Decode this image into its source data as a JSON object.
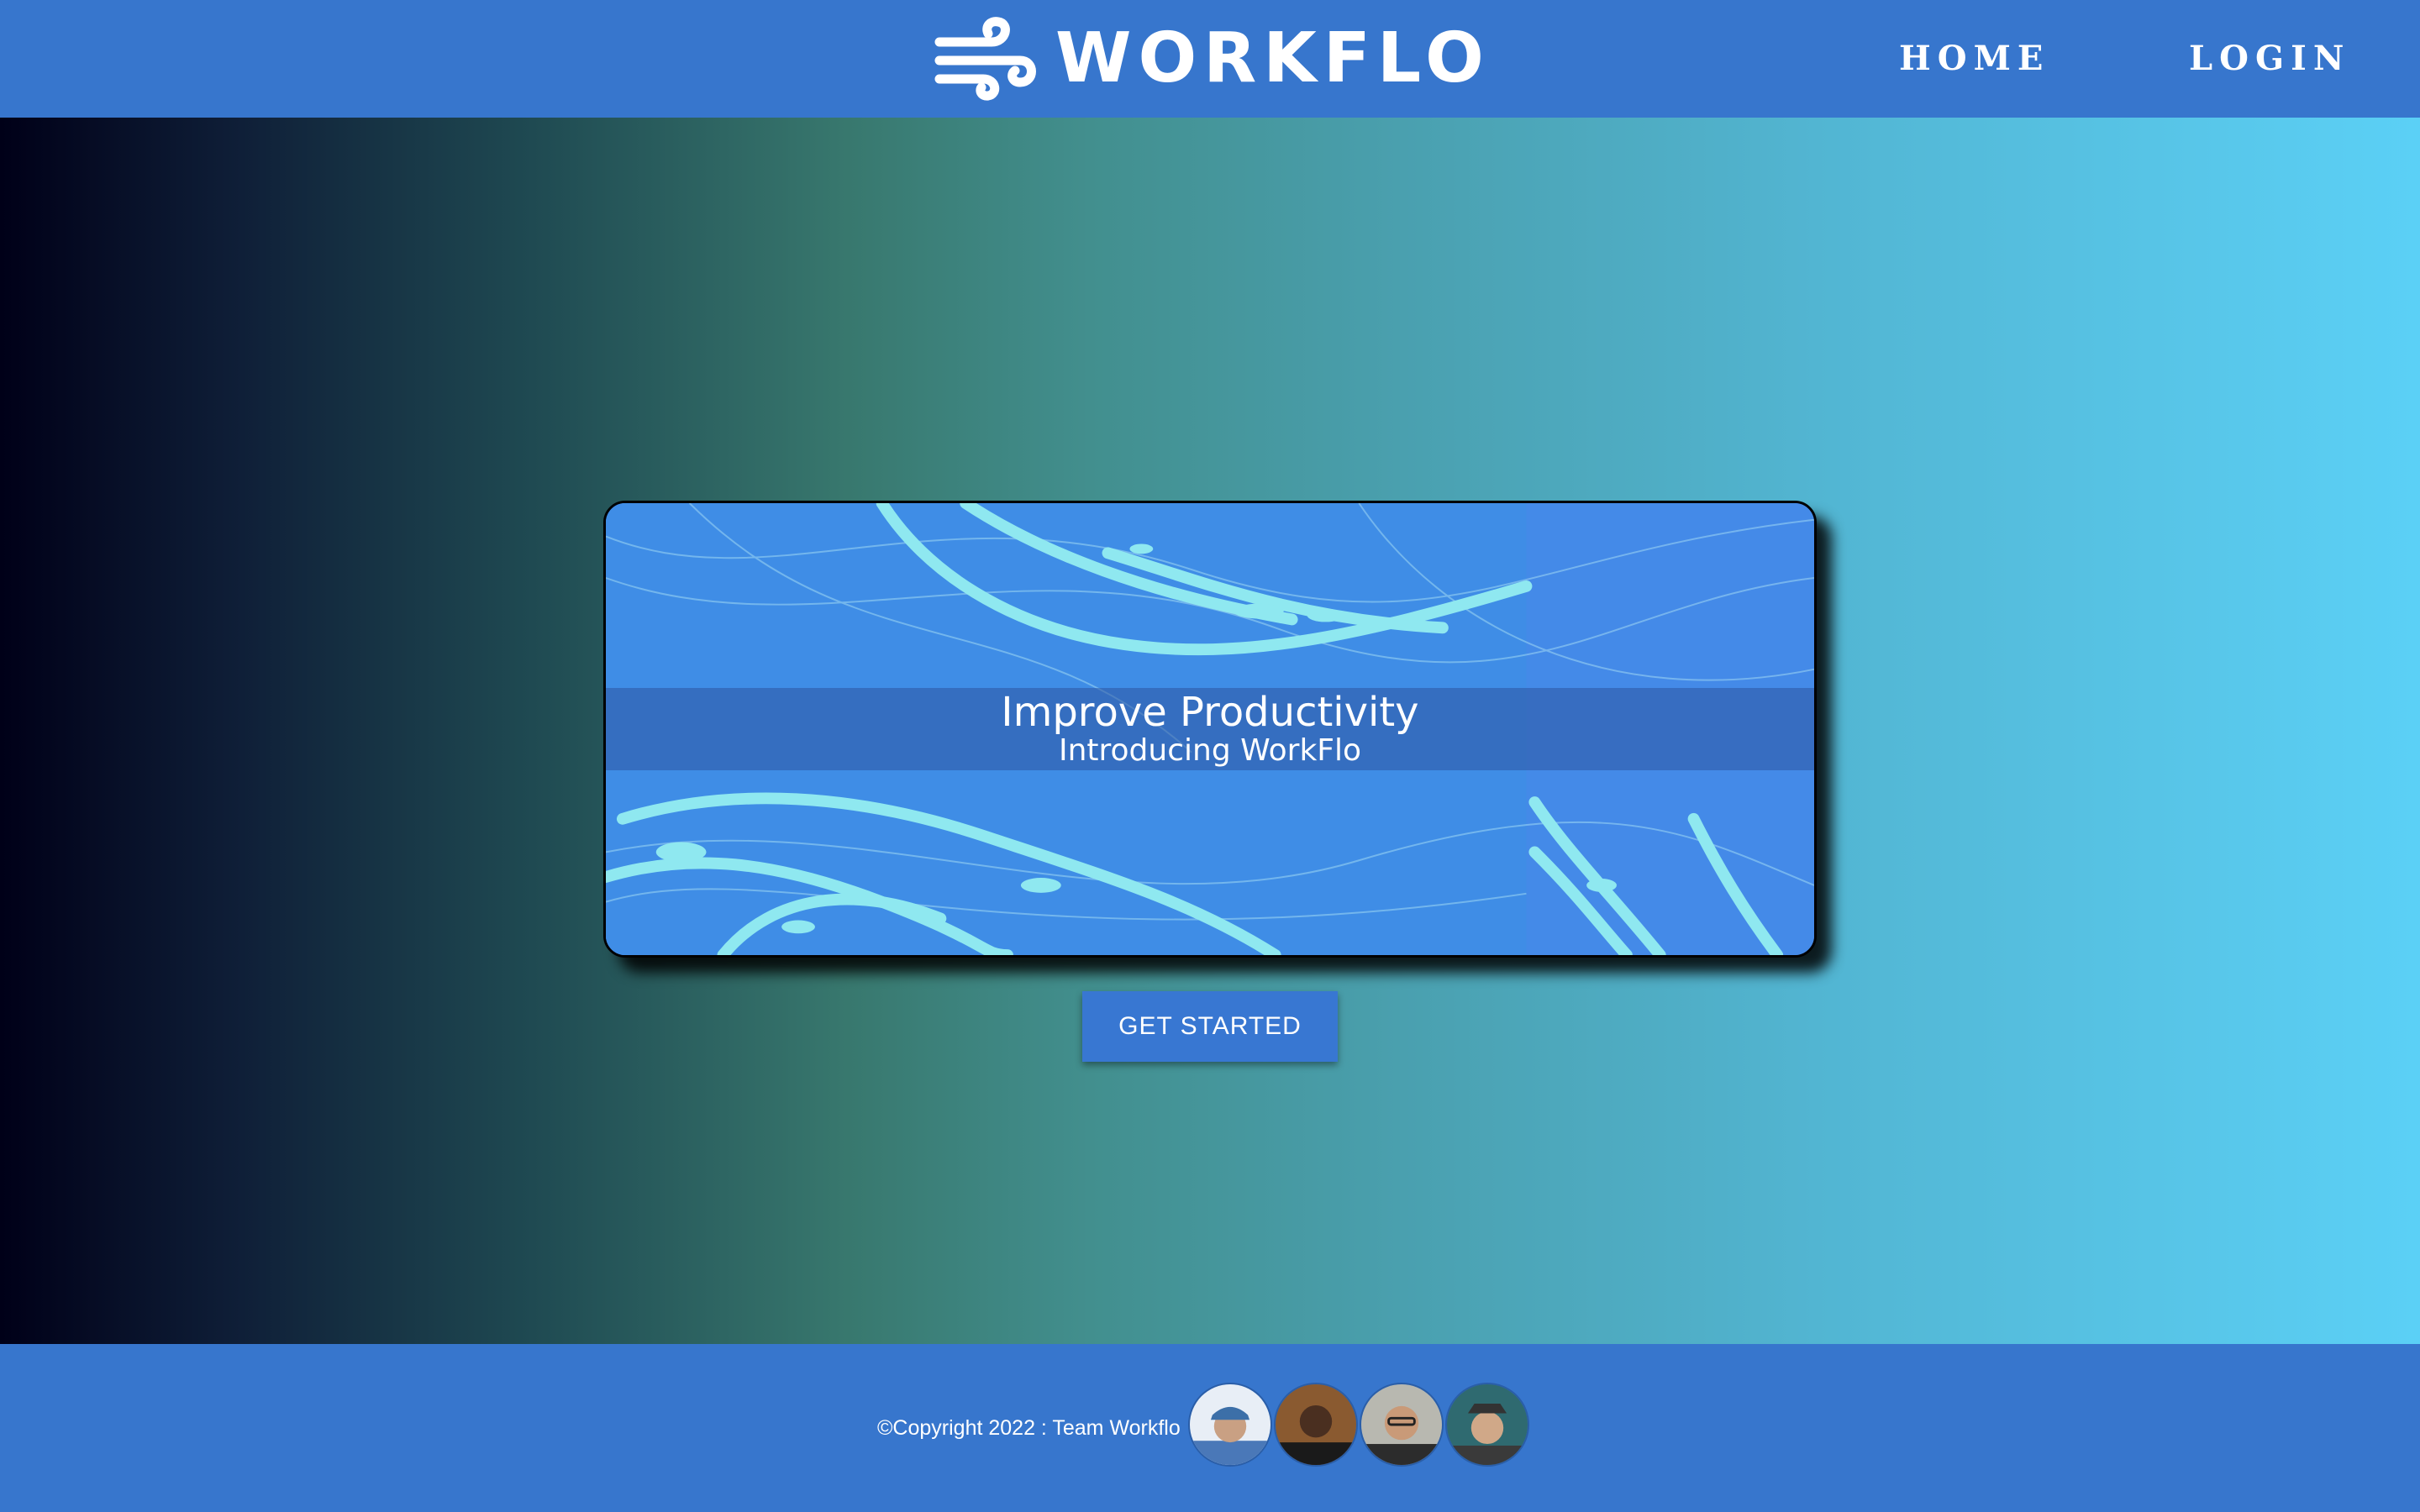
{
  "header": {
    "brand": "WORKFLO",
    "logo_icon": "wind-icon",
    "nav": [
      {
        "label": "HOME"
      },
      {
        "label": "LOGIN"
      }
    ]
  },
  "banner": {
    "title": "Improve Productivity",
    "subtitle": "Introducing WorkFlo"
  },
  "cta": {
    "label": "GET STARTED"
  },
  "footer": {
    "copyright": "©Copyright 2022 : Team Workflo",
    "avatars": [
      "avatar-1",
      "avatar-2",
      "avatar-3",
      "avatar-4"
    ]
  },
  "colors": {
    "header_bg": "#3776cd",
    "banner_bg": "#448ae8",
    "wave_color": "#8fe8f0",
    "button_bg": "#3877d2"
  }
}
